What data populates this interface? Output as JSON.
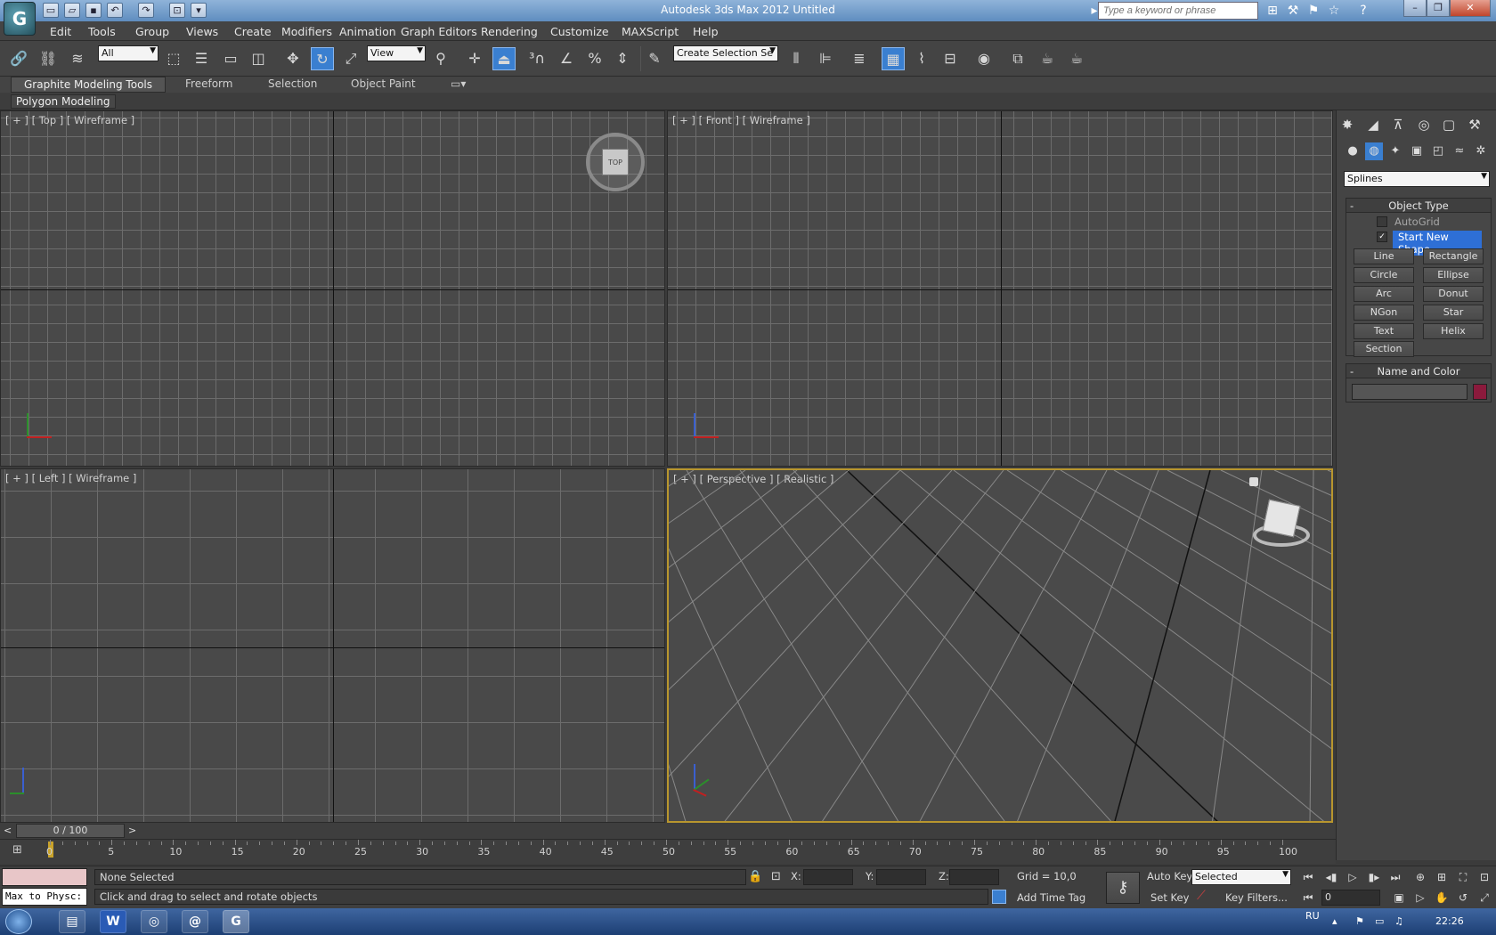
{
  "window": {
    "title": "Autodesk 3ds Max  2012     Untitled",
    "search_placeholder": "Type a keyword or phrase"
  },
  "menus": [
    "Edit",
    "Tools",
    "Group",
    "Views",
    "Create",
    "Modifiers",
    "Animation",
    "Graph Editors",
    "Rendering",
    "Customize",
    "MAXScript",
    "Help"
  ],
  "toolbar": {
    "filter_value": "All",
    "refcoord_value": "View",
    "named_selection_value": "Create Selection Se"
  },
  "ribbon": {
    "tabs": [
      "Graphite Modeling Tools",
      "Freeform",
      "Selection",
      "Object Paint"
    ],
    "panel": "Polygon Modeling"
  },
  "viewports": {
    "top": {
      "label": "[ + ] [ Top ] [ Wireframe ]",
      "cube_label": "TOP"
    },
    "front": {
      "label": "[ + ] [ Front ] [ Wireframe ]"
    },
    "left": {
      "label": "[ + ] [ Left ] [ Wireframe ]"
    },
    "perspective": {
      "label": "[ + ] [ Perspective ] [ Realistic ]"
    }
  },
  "command_panel": {
    "category": "Splines",
    "object_type": {
      "title": "Object Type",
      "autogrid": "AutoGrid",
      "start_new_shape": "Start New Shape",
      "buttons": [
        "Line",
        "Rectangle",
        "Circle",
        "Ellipse",
        "Arc",
        "Donut",
        "NGon",
        "Star",
        "Text",
        "Helix",
        "Section"
      ]
    },
    "name_color": {
      "title": "Name and Color",
      "color": "#8b1a3c"
    }
  },
  "time": {
    "slider": "0 / 100",
    "ticks": [
      "0",
      "5",
      "10",
      "15",
      "20",
      "25",
      "30",
      "35",
      "40",
      "45",
      "50",
      "55",
      "60",
      "65",
      "70",
      "75",
      "80",
      "85",
      "90",
      "95",
      "100"
    ]
  },
  "status": {
    "maxscript": "Max to Physc:",
    "selection": "None Selected",
    "prompt": "Click and drag to select and rotate objects",
    "x_label": "X:",
    "y_label": "Y:",
    "z_label": "Z:",
    "grid": "Grid = 10,0",
    "add_time_tag": "Add Time Tag",
    "auto_key": "Auto Key",
    "set_key": "Set Key",
    "key_mode": "Selected",
    "key_filters": "Key Filters...",
    "frame": "0"
  },
  "taskbar": {
    "lang": "RU",
    "time": "22:26"
  }
}
